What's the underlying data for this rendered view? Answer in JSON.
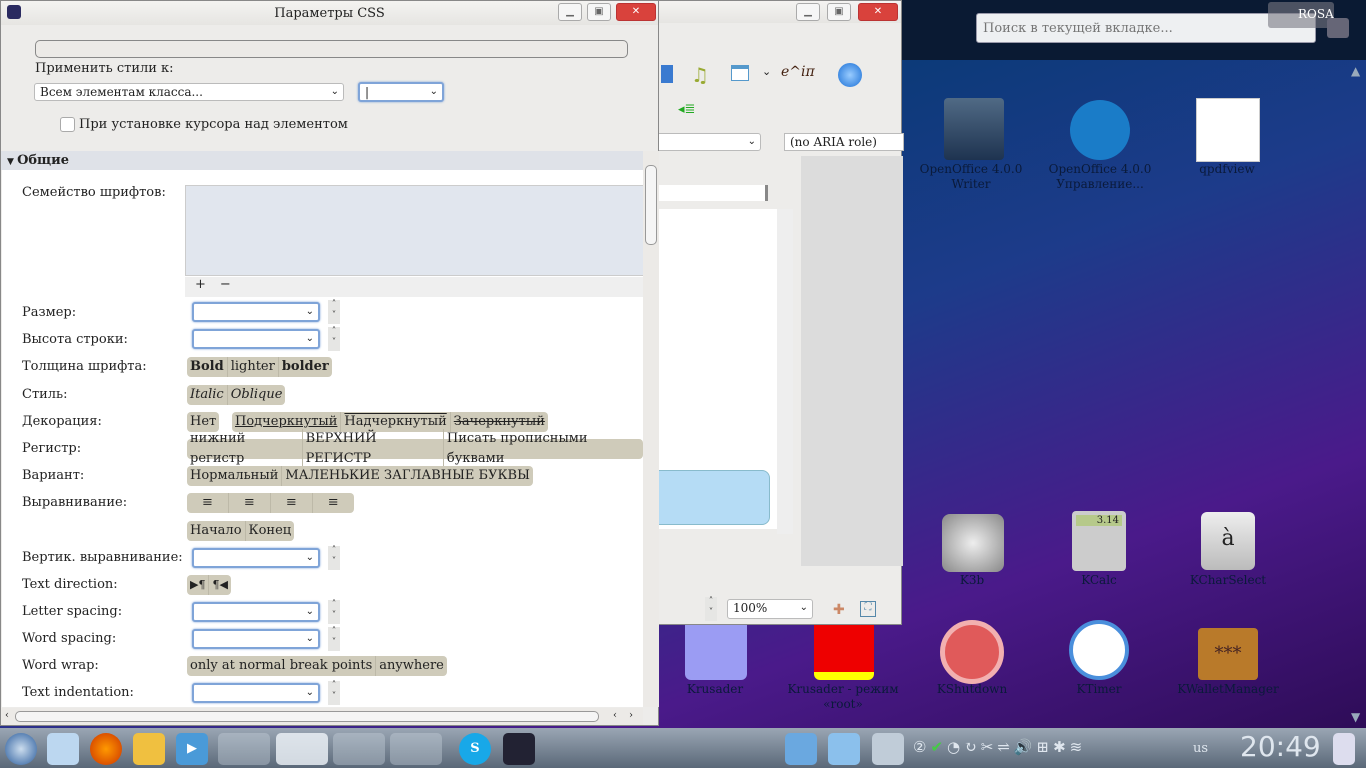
{
  "dialog": {
    "title": "Параметры CSS",
    "apply_label": "Применить стили к:",
    "apply_select": "Всем элементам класса...",
    "hover_checkbox": "При установке курсора над элементом",
    "section": "Общие",
    "rows": {
      "font_family": "Семейство шрифтов:",
      "list_add": "+",
      "list_remove": "−",
      "size": "Размер:",
      "line_height": "Высота строки:",
      "weight": "Толщина шрифта:",
      "style": "Стиль:",
      "decoration": "Декорация:",
      "case": "Регистр:",
      "variant": "Вариант:",
      "align": "Выравнивание:",
      "valign": "Вертик. выравнивание:",
      "direction": "Text direction:",
      "letter_spacing": "Letter spacing:",
      "word_spacing": "Word spacing:",
      "word_wrap": "Word wrap:",
      "indent": "Text indentation:"
    },
    "weight_opts": [
      "Bold",
      "lighter",
      "bolder"
    ],
    "style_opts": [
      "Italic",
      "Oblique"
    ],
    "deco_none": "Нет",
    "deco_opts": [
      "Подчеркнутый",
      "Надчеркнутый",
      "Зачеркнутый"
    ],
    "case_opts": [
      "нижний регистр",
      "ВЕРХНИЙ РЕГИСТР",
      "Писать прописными буквами"
    ],
    "variant_opts": [
      "Нормальный",
      "МАЛЕНЬКИЕ ЗАГЛАВНЫЕ БУКВЫ"
    ],
    "align_opts": [
      "≡",
      "≡",
      "≡",
      "≡"
    ],
    "start_end": [
      "Начало",
      "Конец"
    ],
    "dir_opts": [
      "▶¶",
      "¶◀"
    ],
    "wrap_opts": [
      "only at normal break points",
      "anywhere"
    ]
  },
  "back_window": {
    "aria": "(no ARIA role)",
    "zoom": "100%",
    "math": "e^iπ"
  },
  "desktop": {
    "search_placeholder": "Поиск в текущей вкладке...",
    "user": "ROSA",
    "apps": [
      {
        "name": "OpenOffice 4.0.0 Writer"
      },
      {
        "name": "OpenOffice 4.0.0 Управление..."
      },
      {
        "name": "qpdfview"
      },
      {
        "name": "K3b"
      },
      {
        "name": "KCalc"
      },
      {
        "name": "KCharSelect"
      },
      {
        "name": "Krusader"
      },
      {
        "name": "Krusader - режим «root»"
      },
      {
        "name": "KShutdown"
      },
      {
        "name": "KTimer"
      },
      {
        "name": "KWalletManager"
      }
    ],
    "calc_display": "3.14"
  },
  "taskbar": {
    "layout": "us",
    "clock": "20:49"
  }
}
